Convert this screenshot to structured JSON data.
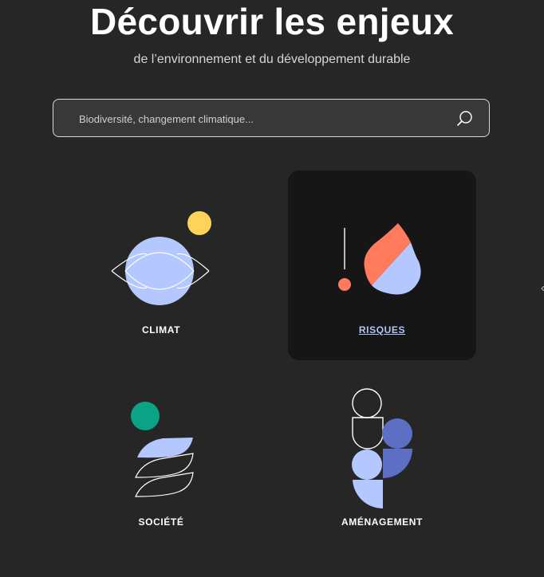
{
  "header": {
    "title": "Découvrir les enjeux",
    "subtitle": "de l’environnement et du développement durable"
  },
  "search": {
    "placeholder": "Biodiversité, changement climatique...",
    "value": "",
    "icon": "search-icon"
  },
  "topics": [
    {
      "label": "CLIMAT",
      "icon": "planet-icon",
      "active": false
    },
    {
      "label": "RISQUES",
      "icon": "fire-alert-icon",
      "active": true
    },
    {
      "label": "SOCIÉTÉ",
      "icon": "society-icon",
      "active": false
    },
    {
      "label": "AMÉNAGEMENT",
      "icon": "planning-icon",
      "active": false
    }
  ],
  "colors": {
    "background": "#262626",
    "card_active": "#161616",
    "yellow": "#ffd35a",
    "light_blue": "#b4c8ff",
    "coral": "#ff7b5c",
    "green": "#0aa386",
    "indigo": "#5c6fc4",
    "active_link": "#b4c4f8"
  }
}
